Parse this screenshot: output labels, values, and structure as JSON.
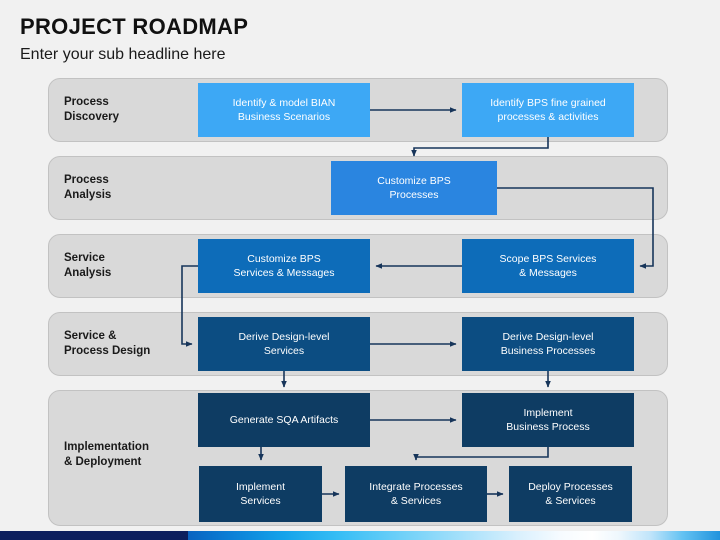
{
  "header": {
    "title": "PROJECT ROADMAP",
    "subtitle": "Enter your sub headline here"
  },
  "colors": {
    "page_background": "#f1f1f1",
    "lane_background": "#d9d9d9",
    "lane_border": "#c2c2c2",
    "box_light_blue": "#3da8f5",
    "box_mid_blue": "#2a85e0",
    "box_medium_blue": "#0d6cb9",
    "box_dark_blue": "#0c4d82",
    "box_navy_blue": "#0e3c63",
    "connector": "#17355a",
    "footer_navy": "#0d1f5e",
    "text_on_box": "#ffffff",
    "heading_text": "#111111"
  },
  "lanes": [
    {
      "id": "process-discovery",
      "label": "Process\nDiscovery",
      "boxes": [
        {
          "id": "identify-model-bian",
          "label": "Identify & model BIAN\nBusiness Scenarios",
          "color": "box_light_blue"
        },
        {
          "id": "identify-bps-fine-grained",
          "label": "Identify BPS fine grained\nprocesses & activities",
          "color": "box_light_blue"
        }
      ]
    },
    {
      "id": "process-analysis",
      "label": "Process\nAnalysis",
      "boxes": [
        {
          "id": "customize-bps-processes",
          "label": "Customize BPS\nProcesses",
          "color": "box_mid_blue"
        }
      ]
    },
    {
      "id": "service-analysis",
      "label": "Service\nAnalysis",
      "boxes": [
        {
          "id": "customize-bps-services",
          "label": "Customize BPS\nServices & Messages",
          "color": "box_medium_blue"
        },
        {
          "id": "scope-bps-services",
          "label": "Scope BPS Services\n& Messages",
          "color": "box_medium_blue"
        }
      ]
    },
    {
      "id": "service-process-design",
      "label": "Service &\nProcess Design",
      "boxes": [
        {
          "id": "derive-design-level-services",
          "label": "Derive Design-level\nServices",
          "color": "box_dark_blue"
        },
        {
          "id": "derive-design-level-business-processes",
          "label": "Derive Design-level\nBusiness Processes",
          "color": "box_dark_blue"
        }
      ]
    },
    {
      "id": "implementation-deployment",
      "label": "Implementation\n& Deployment",
      "boxes": [
        {
          "id": "generate-sqa-artifacts",
          "label": "Generate SQA Artifacts",
          "color": "box_navy_blue"
        },
        {
          "id": "implement-business-process",
          "label": "Implement\nBusiness Process",
          "color": "box_navy_blue"
        },
        {
          "id": "implement-services",
          "label": "Implement\nServices",
          "color": "box_navy_blue"
        },
        {
          "id": "integrate-processes-services",
          "label": "Integrate Processes\n& Services",
          "color": "box_navy_blue"
        },
        {
          "id": "deploy-processes-services",
          "label": "Deploy Processes\n& Services",
          "color": "box_navy_blue"
        }
      ]
    }
  ],
  "connections": [
    {
      "from": "identify-model-bian",
      "to": "identify-bps-fine-grained"
    },
    {
      "from": "identify-bps-fine-grained",
      "to": "customize-bps-processes"
    },
    {
      "from": "customize-bps-processes",
      "to": "scope-bps-services"
    },
    {
      "from": "scope-bps-services",
      "to": "customize-bps-services"
    },
    {
      "from": "customize-bps-services",
      "to": "derive-design-level-services"
    },
    {
      "from": "derive-design-level-services",
      "to": "derive-design-level-business-processes"
    },
    {
      "from": "derive-design-level-services",
      "to": "generate-sqa-artifacts"
    },
    {
      "from": "derive-design-level-business-processes",
      "to": "implement-business-process"
    },
    {
      "from": "generate-sqa-artifacts",
      "to": "implement-business-process"
    },
    {
      "from": "generate-sqa-artifacts",
      "to": "implement-services"
    },
    {
      "from": "implement-services",
      "to": "integrate-processes-services"
    },
    {
      "from": "implement-business-process",
      "to": "integrate-processes-services"
    },
    {
      "from": "integrate-processes-services",
      "to": "deploy-processes-services"
    }
  ]
}
